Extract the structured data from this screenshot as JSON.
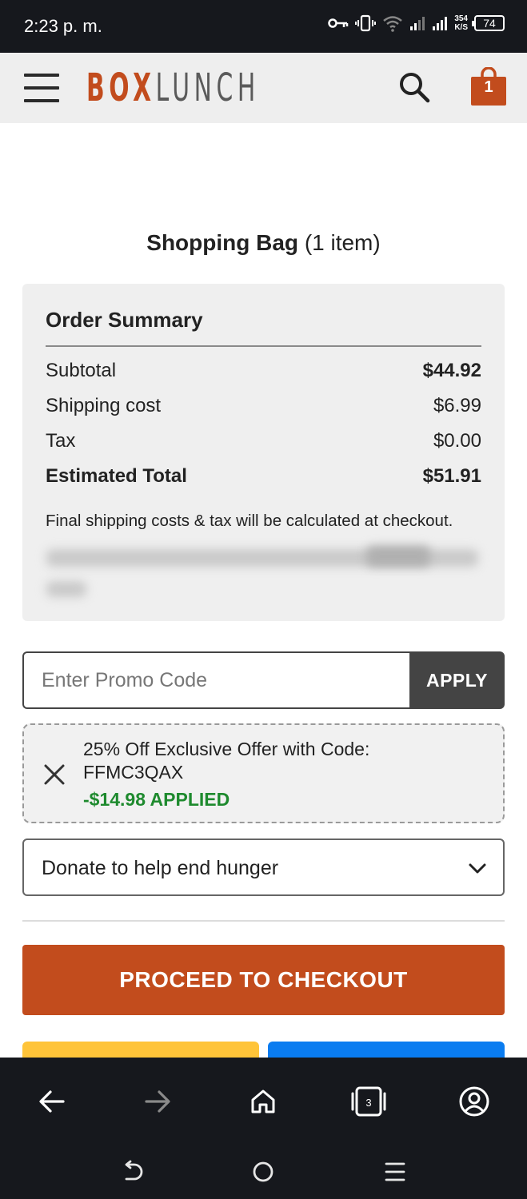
{
  "status_bar": {
    "time": "2:23 p. m.",
    "network_speed_value": "354",
    "network_speed_unit": "K/S",
    "battery": "74"
  },
  "header": {
    "logo_primary": "BOX",
    "logo_secondary": "LUNCH",
    "bag_count": "1",
    "brand_color": "#c24c1d"
  },
  "page": {
    "title": "Shopping Bag",
    "item_count": "(1 item)"
  },
  "order_summary": {
    "title": "Order Summary",
    "rows": [
      {
        "label": "Subtotal",
        "value": "$44.92"
      },
      {
        "label": "Shipping cost",
        "value": "$6.99"
      },
      {
        "label": "Tax",
        "value": "$0.00"
      },
      {
        "label": "Estimated Total",
        "value": "$51.91"
      }
    ],
    "note": "Final shipping costs & tax will be calculated at checkout."
  },
  "promo": {
    "placeholder": "Enter Promo Code",
    "apply_label": "APPLY"
  },
  "offer": {
    "line1": "25% Off Exclusive Offer with Code:",
    "code": "FFMC3QAX",
    "applied": "-$14.98 APPLIED",
    "applied_color": "#1e8a2e"
  },
  "donate": {
    "selected": "Donate to help end hunger"
  },
  "checkout": {
    "label": "PROCEED TO CHECKOUT"
  },
  "browser_nav": {
    "tab_count": "3"
  },
  "icons": {
    "header": [
      "hamburger-menu-icon",
      "search-icon",
      "shopping-bag-icon"
    ],
    "browser": [
      "back-arrow-icon",
      "forward-arrow-icon",
      "home-icon",
      "tabs-icon",
      "account-icon"
    ],
    "system": [
      "back-gesture-icon",
      "home-circle-icon",
      "recents-icon"
    ]
  }
}
